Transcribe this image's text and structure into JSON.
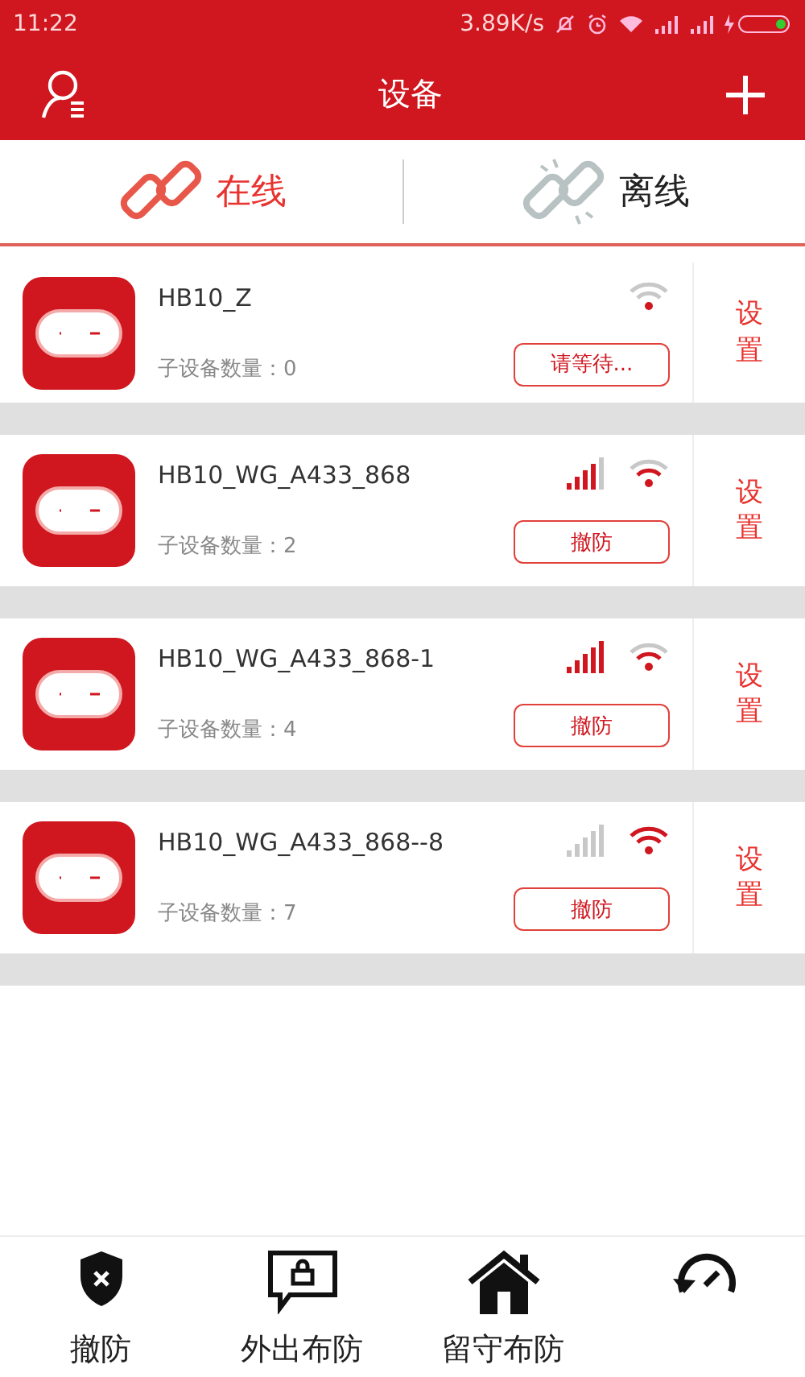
{
  "status_bar": {
    "time": "11:22",
    "speed": "3.89K/s"
  },
  "header": {
    "title": "设备"
  },
  "tabs": [
    {
      "label": "在线",
      "selected": true
    },
    {
      "label": "离线",
      "selected": false
    }
  ],
  "devices": [
    {
      "name": "HB10_Z",
      "sub_count_label": "子设备数量：0",
      "action": "请等待...",
      "settings": "设置",
      "wifi": {
        "inner_arc": false,
        "outer_arc": false
      }
    },
    {
      "name": "HB10_WG_A433_868",
      "sub_count_label": "子设备数量：2",
      "action": "撤防",
      "settings": "设置",
      "cellular": {
        "active": true,
        "full": false
      },
      "wifi": {
        "inner_arc": true,
        "outer_arc": false
      }
    },
    {
      "name": "HB10_WG_A433_868-1",
      "sub_count_label": "子设备数量：4",
      "action": "撤防",
      "settings": "设置",
      "cellular": {
        "active": true,
        "full": true
      },
      "wifi": {
        "inner_arc": true,
        "outer_arc": false
      }
    },
    {
      "name": "HB10_WG_A433_868--8",
      "sub_count_label": "子设备数量：7",
      "action": "撤防",
      "settings": "设置",
      "cellular": {
        "active": false,
        "full": false
      },
      "wifi": {
        "inner_arc": true,
        "outer_arc": true
      }
    }
  ],
  "bottom_nav": [
    {
      "kind": "disarm",
      "label": "撤防"
    },
    {
      "kind": "away",
      "label": "外出布防"
    },
    {
      "kind": "home",
      "label": "留守布防"
    },
    {
      "kind": "history"
    }
  ]
}
